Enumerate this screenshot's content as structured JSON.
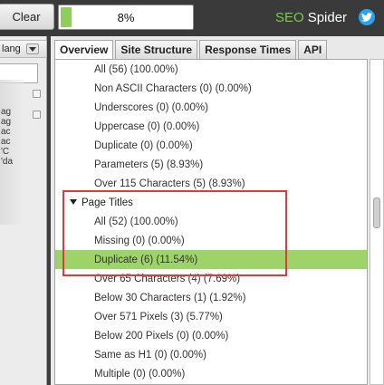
{
  "toolbar": {
    "clear_label": "Clear",
    "progress_text": "8%",
    "progress_fraction": 0.08
  },
  "brand": {
    "seo": "SEO",
    "name": "Spider",
    "twitter_icon": "twitter-icon",
    "accent": "#7ec84a"
  },
  "left_panel": {
    "header_label": "lang",
    "items": [
      "",
      "",
      "ag",
      "ag",
      "ac",
      "ac",
      "'C",
      "'da"
    ]
  },
  "tabs": [
    "Overview",
    "Site Structure",
    "Response Times",
    "API"
  ],
  "tree": {
    "rows": [
      {
        "label": "All (56) (100.00%)"
      },
      {
        "label": "Non ASCII Characters (0) (0.00%)"
      },
      {
        "label": "Underscores (0) (0.00%)"
      },
      {
        "label": "Uppercase (0) (0.00%)"
      },
      {
        "label": "Duplicate (0) (0.00%)"
      },
      {
        "label": "Parameters (5) (8.93%)"
      },
      {
        "label": "Over 115 Characters (5) (8.93%)"
      },
      {
        "label": "Page Titles",
        "section": true
      },
      {
        "label": "All (52) (100.00%)"
      },
      {
        "label": "Missing (0) (0.00%)"
      },
      {
        "label": "Duplicate (6) (11.54%)",
        "selected": true
      },
      {
        "label": "Over 65 Characters (4) (7.69%)"
      },
      {
        "label": "Below 30 Characters (1) (1.92%)"
      },
      {
        "label": "Over 571 Pixels (3) (5.77%)"
      },
      {
        "label": "Below 200 Pixels (0) (0.00%)"
      },
      {
        "label": "Same as H1 (0) (0.00%)"
      },
      {
        "label": "Multiple (0) (0.00%)"
      }
    ],
    "selected_color": "#9ed36a",
    "highlight_color": "#e23a3a"
  }
}
